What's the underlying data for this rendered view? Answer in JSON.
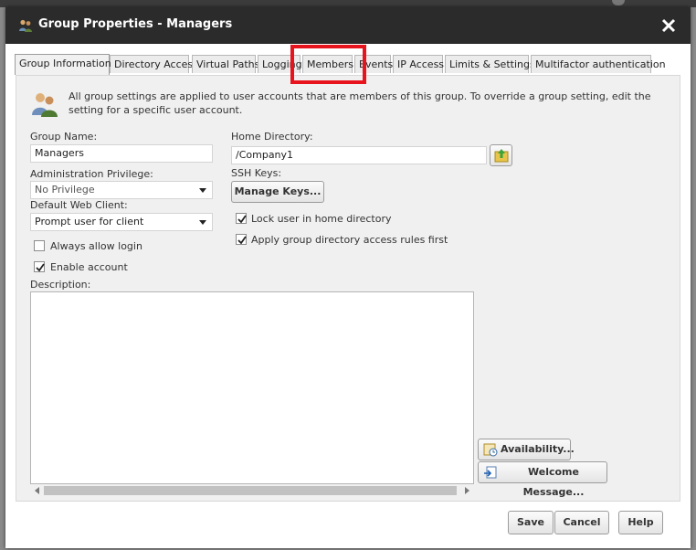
{
  "dialog": {
    "title": "Group Properties - Managers",
    "close_icon": "close-icon"
  },
  "tabs": [
    {
      "label": "Group Information",
      "active": true
    },
    {
      "label": "Directory Access"
    },
    {
      "label": "Virtual Paths"
    },
    {
      "label": "Logging"
    },
    {
      "label": "Members",
      "highlighted": true
    },
    {
      "label": "Events"
    },
    {
      "label": "IP Access"
    },
    {
      "label": "Limits & Settings"
    },
    {
      "label": "Multifactor authentication"
    }
  ],
  "info": {
    "text": "All group settings are applied to user accounts that are members of this group. To override a group setting, edit the setting for a specific user account.",
    "icon": "group-users-icon"
  },
  "form": {
    "group_name_label": "Group Name:",
    "group_name_value": "Managers",
    "admin_priv_label": "Administration Privilege:",
    "admin_priv_value": "No Privilege",
    "default_web_client_label": "Default Web Client:",
    "default_web_client_value": "Prompt user for client",
    "always_allow_login_label": "Always allow login",
    "always_allow_login_checked": false,
    "enable_account_label": "Enable account",
    "enable_account_checked": true,
    "description_label": "Description:",
    "description_value": "",
    "home_dir_label": "Home Directory:",
    "home_dir_value": "/Company1",
    "ssh_keys_label": "SSH Keys:",
    "manage_keys_label": "Manage Keys...",
    "lock_home_label": "Lock user in home directory",
    "lock_home_checked": true,
    "apply_rules_first_label": "Apply group directory access rules first",
    "apply_rules_first_checked": true
  },
  "side_buttons": {
    "availability_label": "Availability...",
    "welcome_message_label": "Welcome Message..."
  },
  "footer": {
    "save_label": "Save",
    "cancel_label": "Cancel",
    "help_label": "Help"
  },
  "colors": {
    "titlebar": "#2b2b2b",
    "highlight_box": "#e8141d",
    "panel_bg": "#f0f0f0"
  }
}
